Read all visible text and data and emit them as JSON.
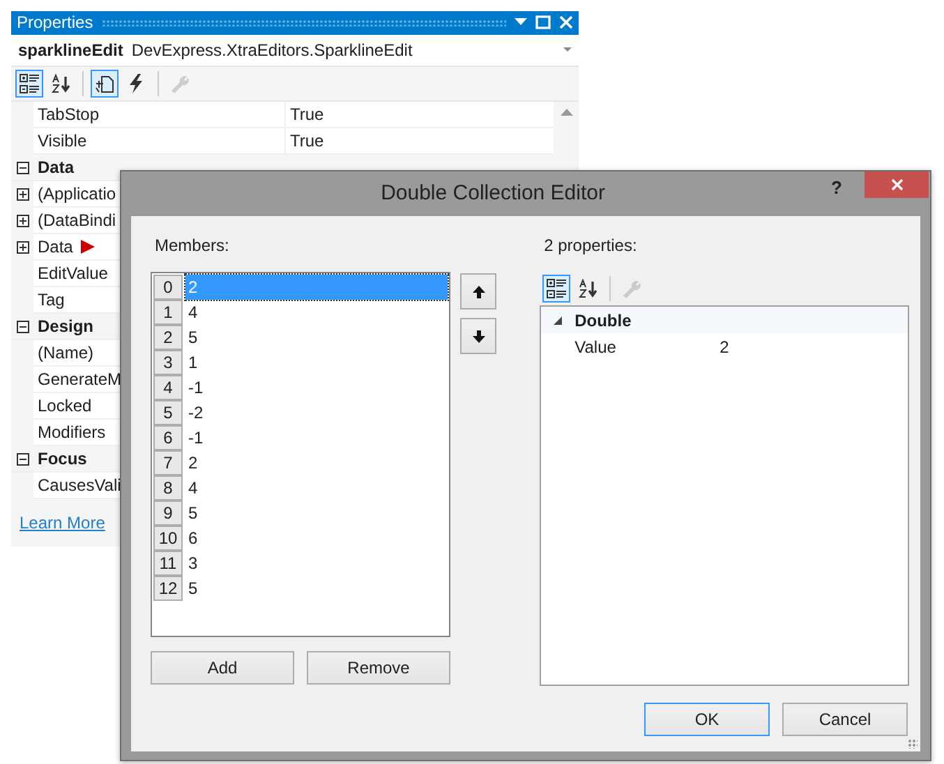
{
  "properties_panel": {
    "title": "Properties",
    "object_name": "sparklineEdit",
    "object_type": "DevExpress.XtraEditors.SparklineEdit",
    "toolbar": [
      {
        "kind": "categorized",
        "selected": true,
        "disabled": false
      },
      {
        "kind": "alphabetical",
        "selected": false,
        "disabled": false
      },
      {
        "kind": "properties",
        "selected": true,
        "disabled": false
      },
      {
        "kind": "events",
        "selected": false,
        "disabled": false
      },
      {
        "kind": "pages",
        "selected": false,
        "disabled": true
      }
    ],
    "rows": [
      {
        "kind": "property",
        "name": "TabStop",
        "value": "True"
      },
      {
        "kind": "property",
        "name": "Visible",
        "value": "True"
      },
      {
        "kind": "category",
        "name": "Data",
        "expanded": true
      },
      {
        "kind": "property",
        "name": "(Applicatio",
        "expanded": false
      },
      {
        "kind": "property",
        "name": "(DataBindi",
        "expanded": false
      },
      {
        "kind": "property",
        "name": "Data",
        "expanded": false,
        "marker": true
      },
      {
        "kind": "property",
        "name": "EditValue"
      },
      {
        "kind": "property",
        "name": "Tag"
      },
      {
        "kind": "category",
        "name": "Design",
        "expanded": true
      },
      {
        "kind": "property",
        "name": "(Name)"
      },
      {
        "kind": "property",
        "name": "GenerateM"
      },
      {
        "kind": "property",
        "name": "Locked"
      },
      {
        "kind": "property",
        "name": "Modifiers"
      },
      {
        "kind": "category",
        "name": "Focus",
        "expanded": true
      },
      {
        "kind": "property",
        "name": "CausesVali"
      }
    ],
    "link": "Learn More"
  },
  "dialog": {
    "title": "Double Collection Editor",
    "help": "?",
    "members_label": "Members:",
    "members": [
      {
        "index": "0",
        "value": "2",
        "selected": true
      },
      {
        "index": "1",
        "value": "4",
        "selected": false
      },
      {
        "index": "2",
        "value": "5",
        "selected": false
      },
      {
        "index": "3",
        "value": "1",
        "selected": false
      },
      {
        "index": "4",
        "value": "-1",
        "selected": false
      },
      {
        "index": "5",
        "value": "-2",
        "selected": false
      },
      {
        "index": "6",
        "value": "-1",
        "selected": false
      },
      {
        "index": "7",
        "value": "2",
        "selected": false
      },
      {
        "index": "8",
        "value": "4",
        "selected": false
      },
      {
        "index": "9",
        "value": "5",
        "selected": false
      },
      {
        "index": "10",
        "value": "6",
        "selected": false
      },
      {
        "index": "11",
        "value": "3",
        "selected": false
      },
      {
        "index": "12",
        "value": "5",
        "selected": false
      }
    ],
    "add_button": "Add",
    "remove_button": "Remove",
    "properties_label": "2 properties:",
    "toolbar": [
      {
        "kind": "categorized",
        "selected": true,
        "disabled": false
      },
      {
        "kind": "alphabetical",
        "selected": false,
        "disabled": false
      },
      {
        "kind": "pages",
        "selected": false,
        "disabled": true
      }
    ],
    "grid": [
      {
        "kind": "category",
        "name": "Double",
        "expanded": true
      },
      {
        "kind": "property",
        "name": "Value",
        "value": "2"
      }
    ],
    "buttons": [
      {
        "label": "OK",
        "default": true
      },
      {
        "label": "Cancel",
        "default": false
      }
    ]
  }
}
